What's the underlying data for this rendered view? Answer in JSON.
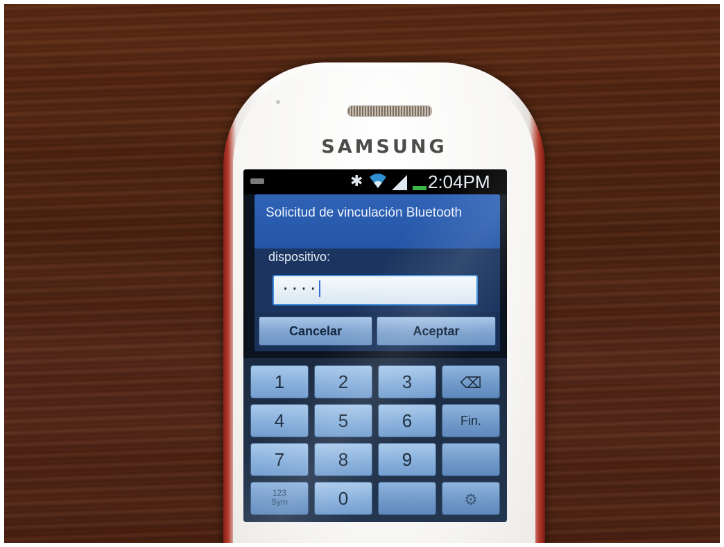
{
  "device": {
    "brand": "SAMSUNG"
  },
  "status_bar": {
    "time": "2:04PM",
    "icons": [
      "keyboard-icon",
      "bluetooth-icon",
      "wifi-icon",
      "signal-icon",
      "battery-icon"
    ]
  },
  "dialog": {
    "title": "Solicitud de vinculación Bluetooth",
    "label": "dispositivo:",
    "pin_value": "····",
    "cancel_label": "Cancelar",
    "accept_label": "Aceptar"
  },
  "keypad": {
    "rows": [
      [
        "1",
        "2",
        "3",
        "⌫"
      ],
      [
        "4",
        "5",
        "6",
        "Fin."
      ],
      [
        "7",
        "8",
        "9",
        ""
      ],
      [
        "123 Sym",
        "0",
        "",
        "⚙"
      ]
    ],
    "key_1": "1",
    "key_2": "2",
    "key_3": "3",
    "key_4": "4",
    "key_5": "5",
    "key_6": "6",
    "key_7": "7",
    "key_8": "8",
    "key_9": "9",
    "key_0": "0",
    "done_label": "Fin.",
    "sym_line1": "123",
    "sym_line2": "Sym",
    "backspace_icon": "⌫",
    "settings_icon": "⚙"
  },
  "colors": {
    "title_bar": "#2f63b6",
    "input_border": "#3f8fe0",
    "key_face": "#a8c9ea"
  }
}
